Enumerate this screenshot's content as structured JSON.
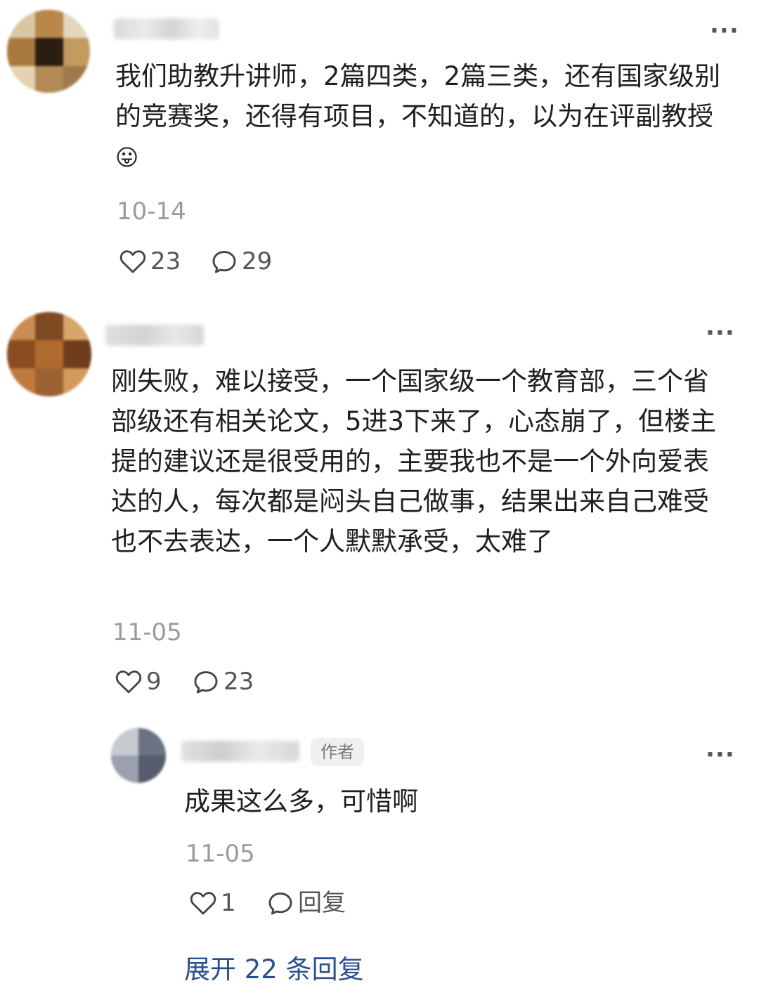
{
  "comments": [
    {
      "text": "我们助教升讲师，2篇四类，2篇三类，还有国家级别的竞赛奖，还得有项目，不知道的，以为在评副教授",
      "emoji": "😛",
      "date": "10-14",
      "likes": "23",
      "replies": "29",
      "more": "···"
    },
    {
      "text": "刚失败，难以接受，一个国家级一个教育部，三个省部级还有相关论文，5进3下来了，心态崩了，但楼主提的建议还是很受用的，主要我也不是一个外向爱表达的人，每次都是闷头自己做事，结果出来自己难受也不去表达，一个人默默承受，太难了",
      "date": "11-05",
      "likes": "9",
      "replies": "23",
      "more": "···"
    }
  ],
  "reply": {
    "badge": "作者",
    "text": "成果这么多，可惜啊",
    "date": "11-05",
    "likes": "1",
    "reply_label": "回复",
    "more": "···"
  },
  "expand_label": "展开 22 条回复",
  "icons": {
    "like": "heart-icon",
    "comment": "comment-bubble-icon",
    "more": "more-dots-icon"
  },
  "colors": {
    "link": "#2a4f8f",
    "meta": "#9b9b9b",
    "text": "#1f1f1f"
  }
}
